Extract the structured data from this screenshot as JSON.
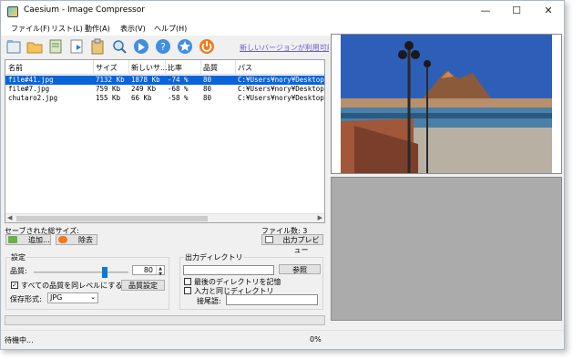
{
  "window": {
    "title": "Caesium - Image Compressor"
  },
  "menu": [
    "ファイル(F)",
    "リスト(L)",
    "動作(A)",
    "表示(V)",
    "ヘルプ(H)"
  ],
  "toolbar": {
    "icons": [
      "open-icon",
      "open-folder-icon",
      "save-icon",
      "export-icon",
      "clipboard-icon",
      "preview-icon",
      "compress-icon",
      "help-icon",
      "star-icon",
      "power-icon"
    ],
    "update_link": "新しいバージョンが利用可能です"
  },
  "list": {
    "columns": [
      "名前",
      "サイズ",
      "新しいサ...",
      "比率",
      "品質",
      "パス"
    ],
    "rows": [
      {
        "name": "file#41.jpg",
        "size": "7132 Kb",
        "new_size": "1878 Kb",
        "ratio": "-74 %",
        "quality": "80",
        "path": "C:¥Users¥nory¥Desktop¥file"
      },
      {
        "name": "file#7.jpg",
        "size": "759 Kb",
        "new_size": "249 Kb",
        "ratio": "-68 %",
        "quality": "80",
        "path": "C:¥Users¥nory¥Desktop¥file"
      },
      {
        "name": "chutaro2.jpg",
        "size": "155 Kb",
        "new_size": "66 Kb",
        "ratio": "-58 %",
        "quality": "80",
        "path": "C:¥Users¥nory¥Desktop¥chu"
      }
    ]
  },
  "summary": {
    "saved_label": "セーブされた総サイズ:",
    "file_count": "ファイル数: 3"
  },
  "buttons": {
    "add": "追加...",
    "remove": "除去",
    "preview": "出力プレビュー"
  },
  "settings": {
    "title": "設定",
    "quality_label": "品質:",
    "quality_value": "80",
    "same_quality_label": "すべての品質を同レベルにする",
    "quality_settings_button": "品質設定",
    "format_label": "保存形式:",
    "format_value": "JPG"
  },
  "output": {
    "title": "出力ディレクトリ",
    "browse_button": "参照",
    "remember_label": "最後のディレクトリを記憶",
    "same_dir_label": "入力と同じディレクトリ",
    "suffix_label": "接尾語:"
  },
  "status": {
    "text": "待機中...",
    "percent": "0%"
  }
}
